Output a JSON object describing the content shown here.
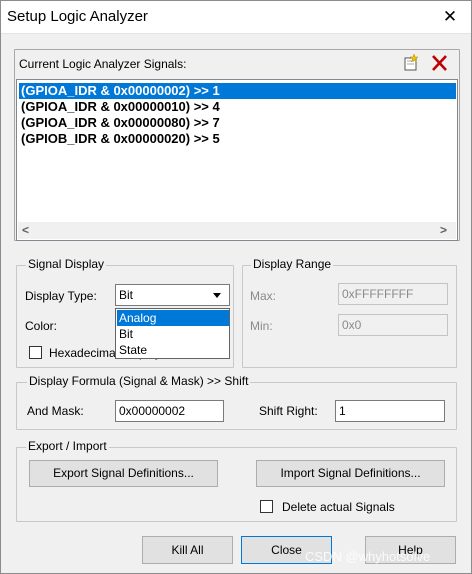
{
  "window": {
    "title": "Setup Logic Analyzer",
    "close_glyph": "✕"
  },
  "signals": {
    "header": "Current Logic Analyzer Signals:",
    "new_icon": "new-signal-icon",
    "delete_icon": "delete-signal-icon",
    "items": [
      "(GPIOA_IDR & 0x00000002) >> 1",
      "(GPIOA_IDR & 0x00000010) >> 4",
      "(GPIOA_IDR & 0x00000080) >> 7",
      "(GPIOB_IDR & 0x00000020) >> 5"
    ],
    "selected_index": 0,
    "scroll_left": "<",
    "scroll_right": ">"
  },
  "signal_display": {
    "legend": "Signal Display",
    "type_label": "Display Type:",
    "type_value": "Bit",
    "type_options": [
      "Analog",
      "Bit",
      "State"
    ],
    "highlighted_option": 0,
    "color_label": "Color:",
    "hex_label": "Hexadecimal Display"
  },
  "display_range": {
    "legend": "Display Range",
    "max_label": "Max:",
    "max_value": "0xFFFFFFFF",
    "min_label": "Min:",
    "min_value": "0x0"
  },
  "formula": {
    "legend": "Display Formula (Signal & Mask) >> Shift",
    "mask_label": "And Mask:",
    "mask_value": "0x00000002",
    "shift_label": "Shift Right:",
    "shift_value": "1"
  },
  "export_import": {
    "legend": "Export / Import",
    "export_button": "Export Signal Definitions...",
    "import_button": "Import Signal Definitions...",
    "delete_label": "Delete actual Signals"
  },
  "buttons": {
    "kill_all": "Kill All",
    "close": "Close",
    "help": "Help"
  },
  "watermark": "CSDN @whyhotsolve",
  "colors": {
    "selection": "#0078d7",
    "delete_icon": "#c00000"
  }
}
